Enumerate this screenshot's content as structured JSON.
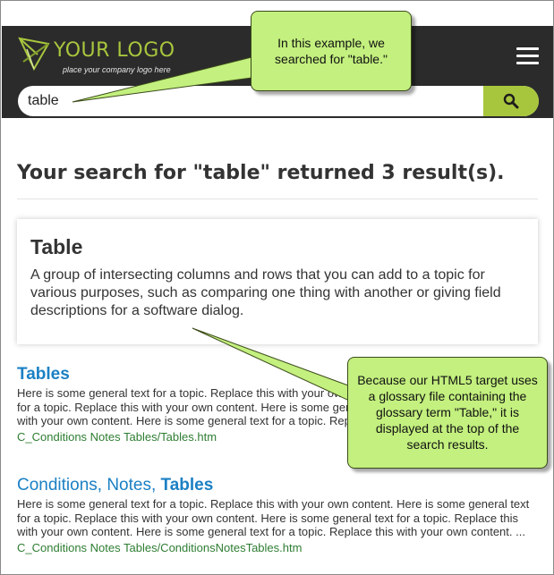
{
  "header": {
    "logo_text": "YOUR LOGO",
    "logo_tagline": "place your company logo here",
    "menu_icon": "hamburger-menu-icon",
    "search": {
      "value": "table",
      "button_icon": "search-magnifier-icon"
    },
    "colors": {
      "background": "#2b2b2b",
      "accent": "#a8c63d"
    }
  },
  "main": {
    "results_heading": "Your search for \"table\" returned 3 result(s).",
    "glossary": {
      "term": "Table",
      "definition": "A group of intersecting columns and rows that you can add to a topic for various purposes, such as comparing one thing with another or giving field descriptions for a software dialog."
    },
    "results": [
      {
        "title_plain": "",
        "title_bold": "Tables",
        "snippet": "Here is some general text for a topic. Replace this with your own content. Here is some general text for a topic. Replace this with your own content. Here is some general text for a topic. Replace this with your own content. Here is some general text for a topic. Replace this with your own content. ...",
        "url": "C_Conditions Notes Tables/Tables.htm"
      },
      {
        "title_plain": "Conditions, Notes, ",
        "title_bold": "Tables",
        "snippet": "Here is some general text for a topic. Replace this with your own content. Here is some general text for a topic. Replace this with your own content. Here is some general text for a topic. Replace this with your own content. Here is some general text for a topic. Replace this with your own content. ...",
        "url": "C_Conditions Notes Tables/ConditionsNotesTables.htm"
      }
    ],
    "colors": {
      "title_link": "#1b80c4",
      "url": "#2e7d32"
    }
  },
  "callouts": [
    {
      "text": "In this example, we searched for \"table.\""
    },
    {
      "text": "Because our HTML5 target uses a glossary file containing the glossary term \"Table,\" it is displayed at the top of the search results."
    }
  ],
  "callout_color": "#c3f07e"
}
